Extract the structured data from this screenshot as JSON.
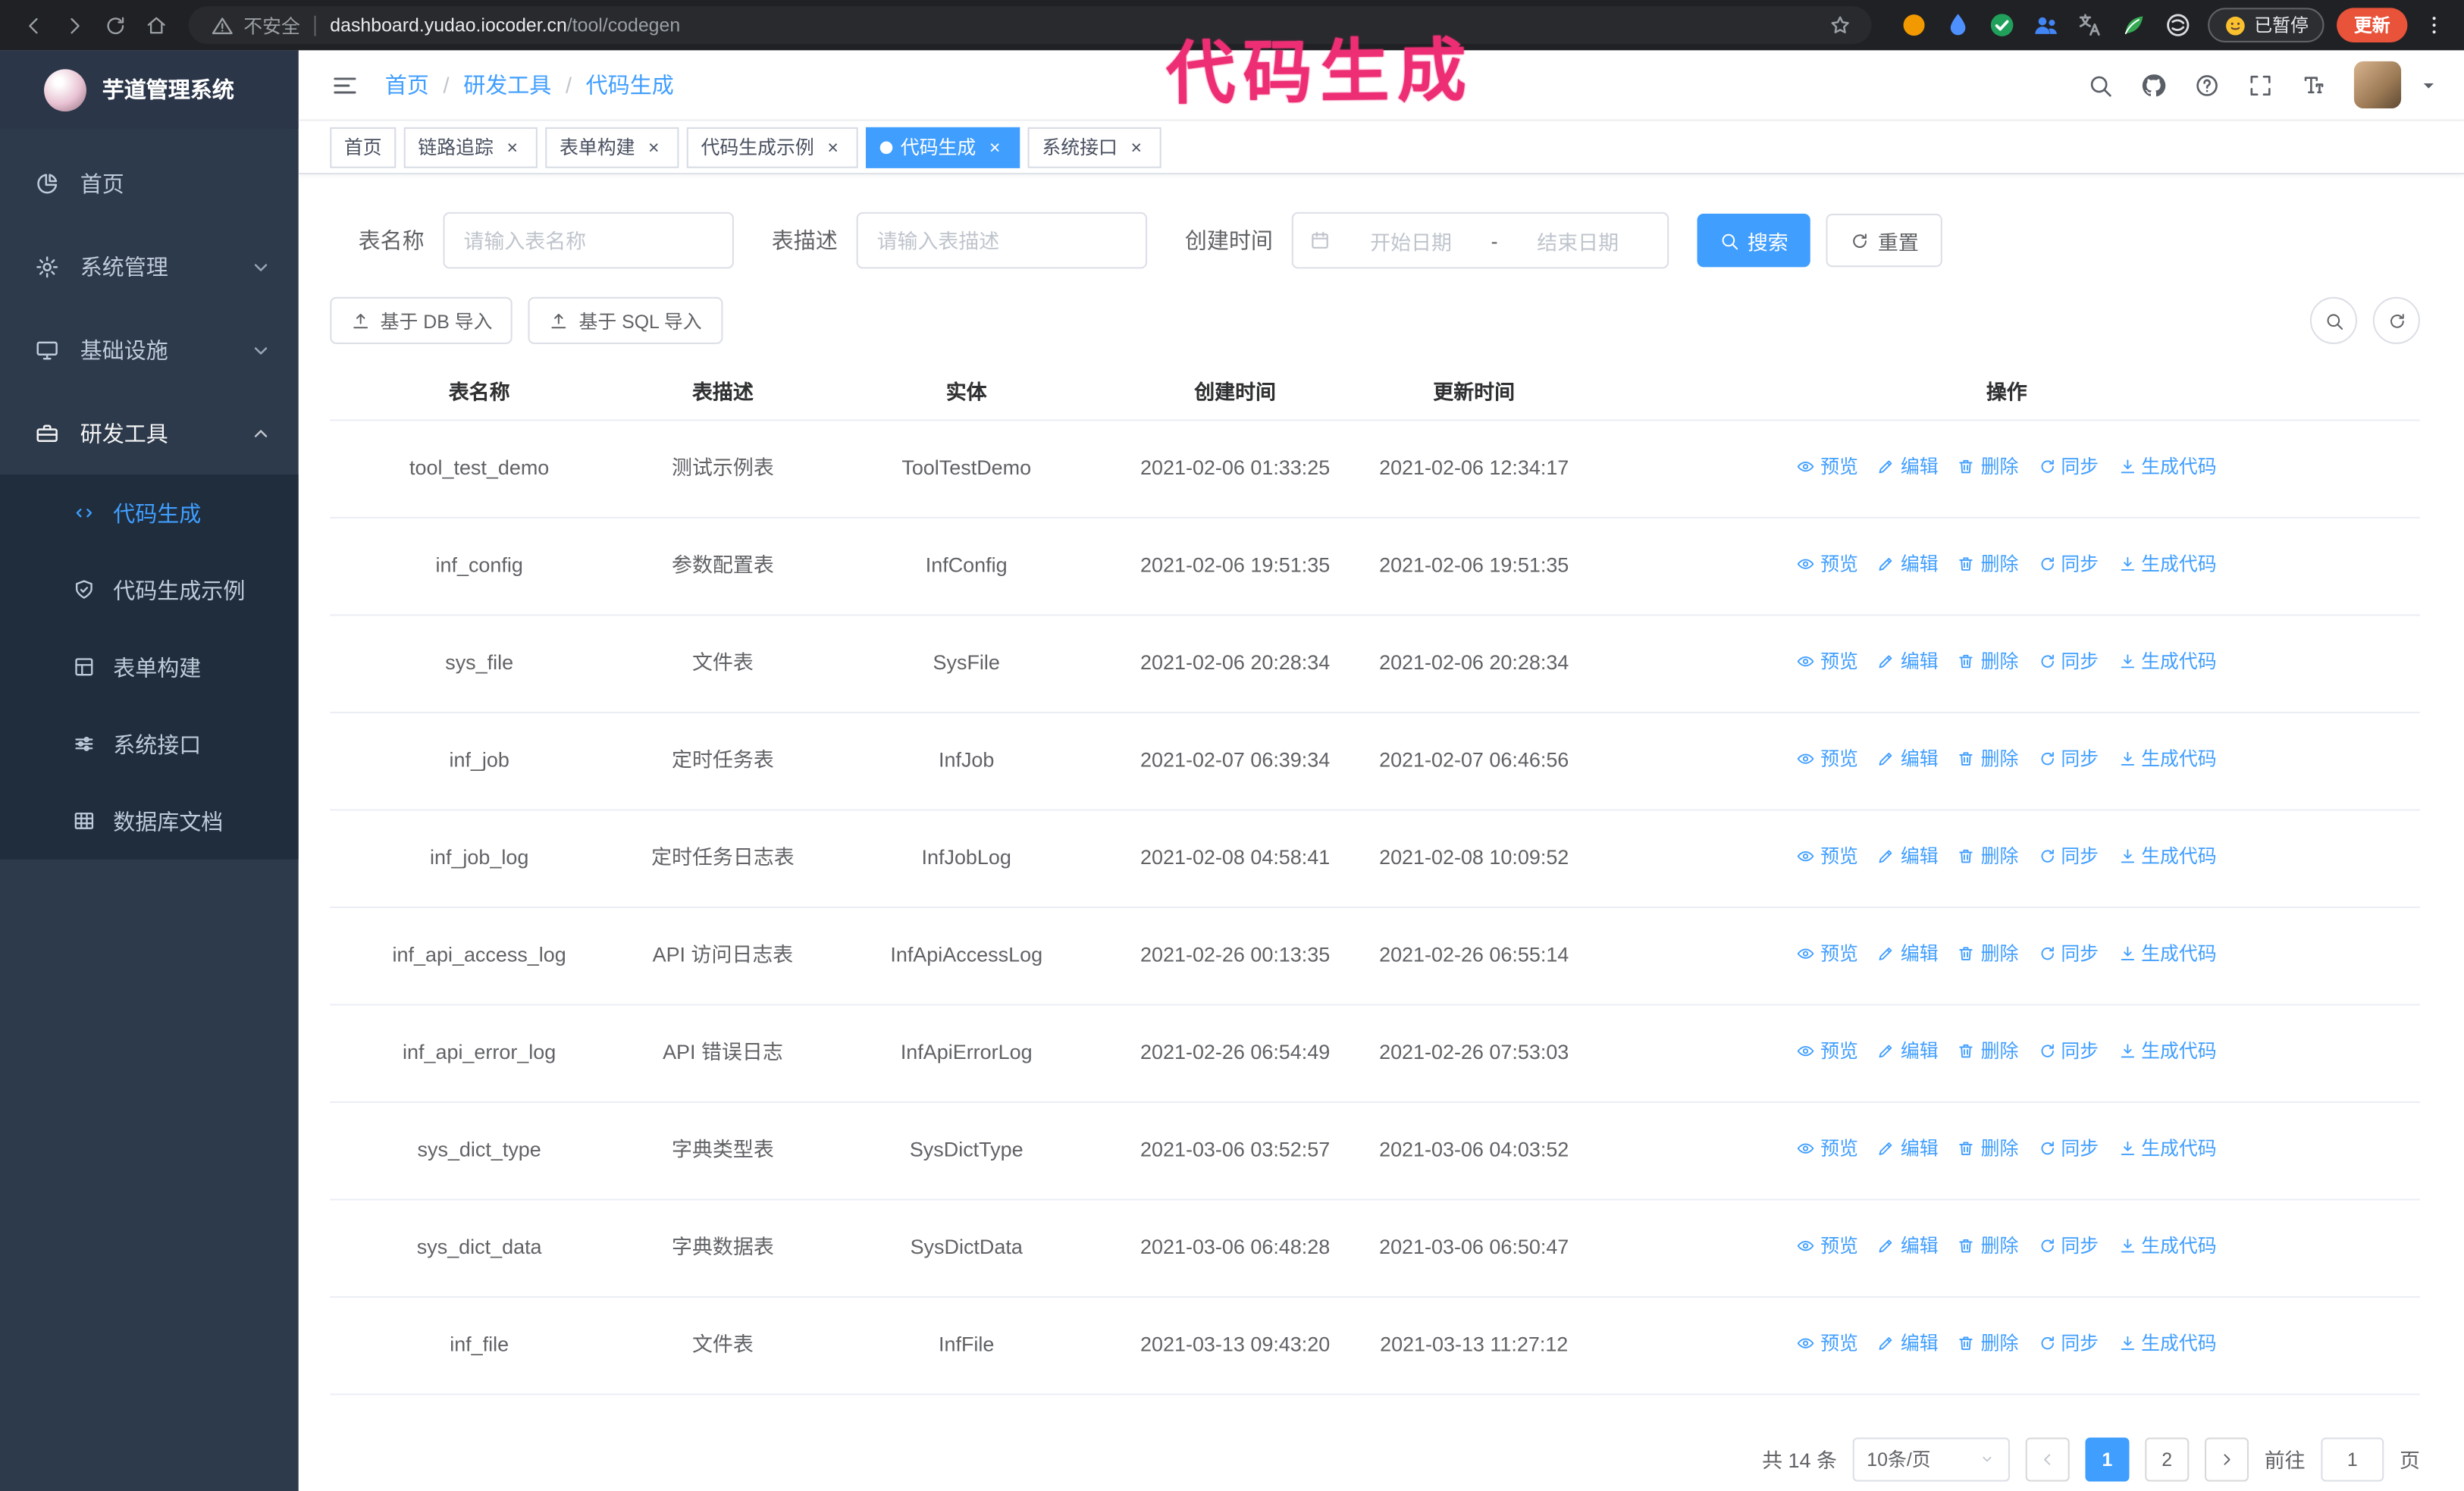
{
  "annotation": {
    "text": "代码生成",
    "color": "#ee2e74"
  },
  "browser": {
    "security_label": "不安全",
    "url_host": "dashboard.yudao.iocoder.cn",
    "url_path": "/tool/codegen",
    "paused_badge_label": "已暂停",
    "update_button_label": "更新",
    "extensions": [
      {
        "icon": "circle",
        "name": "extension-lion-icon",
        "color": "#f29900"
      },
      {
        "icon": "drop",
        "name": "extension-drop-icon",
        "color": "#4d90fe"
      },
      {
        "icon": "check-circle",
        "name": "extension-check-icon",
        "color": "#21a05c"
      },
      {
        "icon": "people",
        "name": "extension-people-icon",
        "color": "#4285f4"
      },
      {
        "icon": "translate",
        "name": "extension-translate-icon",
        "color": "#9aa0a6"
      },
      {
        "icon": "leaf",
        "name": "extension-leaf-icon",
        "color": "#34a853"
      },
      {
        "icon": "knot",
        "name": "extension-knot-icon",
        "color": "#dadce0"
      }
    ]
  },
  "sidebar": {
    "logo_title": "芋道管理系统",
    "menu": [
      {
        "key": "home",
        "label": "首页",
        "icon": "dashboard",
        "chevron": null,
        "expanded": false
      },
      {
        "key": "system",
        "label": "系统管理",
        "icon": "gear",
        "chevron": "down",
        "expanded": false
      },
      {
        "key": "infra",
        "label": "基础设施",
        "icon": "monitor",
        "chevron": "down",
        "expanded": false
      },
      {
        "key": "devtools",
        "label": "研发工具",
        "icon": "toolbox",
        "chevron": "up",
        "expanded": true
      }
    ],
    "submenu": [
      {
        "key": "codegen",
        "label": "代码生成",
        "icon": "code",
        "active": true
      },
      {
        "key": "codegen-example",
        "label": "代码生成示例",
        "icon": "shield-check",
        "active": false
      },
      {
        "key": "form-build",
        "label": "表单构建",
        "icon": "form-grid",
        "active": false
      },
      {
        "key": "system-api",
        "label": "系统接口",
        "icon": "sliders",
        "active": false
      },
      {
        "key": "db-doc",
        "label": "数据库文档",
        "icon": "table-grid",
        "active": false
      }
    ]
  },
  "header": {
    "breadcrumb": {
      "items": [
        "首页",
        "研发工具",
        "代码生成"
      ],
      "separator": "/"
    }
  },
  "tabs": {
    "close_glyph": "×",
    "items": [
      {
        "key": "home",
        "label": "首页",
        "closable": false,
        "active": false
      },
      {
        "key": "tracer",
        "label": "链路追踪",
        "closable": true,
        "active": false
      },
      {
        "key": "form-build",
        "label": "表单构建",
        "closable": true,
        "active": false
      },
      {
        "key": "codegen-example",
        "label": "代码生成示例",
        "closable": true,
        "active": false
      },
      {
        "key": "codegen",
        "label": "代码生成",
        "closable": true,
        "active": true
      },
      {
        "key": "system-api",
        "label": "系统接口",
        "closable": true,
        "active": false
      }
    ]
  },
  "filters": {
    "table_name_label": "表名称",
    "table_name_placeholder": "请输入表名称",
    "table_desc_label": "表描述",
    "table_desc_placeholder": "请输入表描述",
    "create_time_label": "创建时间",
    "date_start_placeholder": "开始日期",
    "date_separator": "-",
    "date_end_placeholder": "结束日期",
    "search_label": "搜索",
    "reset_label": "重置"
  },
  "toolbar": {
    "import_db_label": "基于 DB 导入",
    "import_sql_label": "基于 SQL 导入"
  },
  "table": {
    "columns": [
      "表名称",
      "表描述",
      "实体",
      "创建时间",
      "更新时间",
      "操作"
    ],
    "row_actions": [
      {
        "key": "preview",
        "label": "预览",
        "icon": "eye"
      },
      {
        "key": "edit",
        "label": "编辑",
        "icon": "edit"
      },
      {
        "key": "delete",
        "label": "删除",
        "icon": "trash"
      },
      {
        "key": "sync",
        "label": "同步",
        "icon": "sync"
      },
      {
        "key": "generate",
        "label": "生成代码",
        "icon": "download"
      }
    ],
    "rows": [
      {
        "name": "tool_test_demo",
        "desc": "测试示例表",
        "entity": "ToolTestDemo",
        "created": "2021-02-06 01:33:25",
        "updated": "2021-02-06 12:34:17"
      },
      {
        "name": "inf_config",
        "desc": "参数配置表",
        "entity": "InfConfig",
        "created": "2021-02-06 19:51:35",
        "updated": "2021-02-06 19:51:35"
      },
      {
        "name": "sys_file",
        "desc": "文件表",
        "entity": "SysFile",
        "created": "2021-02-06 20:28:34",
        "updated": "2021-02-06 20:28:34"
      },
      {
        "name": "inf_job",
        "desc": "定时任务表",
        "entity": "InfJob",
        "created": "2021-02-07 06:39:34",
        "updated": "2021-02-07 06:46:56"
      },
      {
        "name": "inf_job_log",
        "desc": "定时任务日志表",
        "entity": "InfJobLog",
        "created": "2021-02-08 04:58:41",
        "updated": "2021-02-08 10:09:52"
      },
      {
        "name": "inf_api_access_log",
        "desc": "API 访问日志表",
        "entity": "InfApiAccessLog",
        "created": "2021-02-26 00:13:35",
        "updated": "2021-02-26 06:55:14"
      },
      {
        "name": "inf_api_error_log",
        "desc": "API 错误日志",
        "entity": "InfApiErrorLog",
        "created": "2021-02-26 06:54:49",
        "updated": "2021-02-26 07:53:03"
      },
      {
        "name": "sys_dict_type",
        "desc": "字典类型表",
        "entity": "SysDictType",
        "created": "2021-03-06 03:52:57",
        "updated": "2021-03-06 04:03:52"
      },
      {
        "name": "sys_dict_data",
        "desc": "字典数据表",
        "entity": "SysDictData",
        "created": "2021-03-06 06:48:28",
        "updated": "2021-03-06 06:50:47"
      },
      {
        "name": "inf_file",
        "desc": "文件表",
        "entity": "InfFile",
        "created": "2021-03-13 09:43:20",
        "updated": "2021-03-13 11:27:12"
      }
    ]
  },
  "pagination": {
    "total_label": "共 14 条",
    "page_size_label": "10条/页",
    "pages": [
      {
        "label": "1",
        "active": true
      },
      {
        "label": "2",
        "active": false
      }
    ],
    "goto_prefix": "前往",
    "goto_value": "1",
    "goto_suffix": "页"
  },
  "colors": {
    "accent": "#409eff",
    "sidebar_bg": "#2d3a4b",
    "submenu_bg": "#1f2d3d",
    "annotation": "#ee2e74"
  }
}
